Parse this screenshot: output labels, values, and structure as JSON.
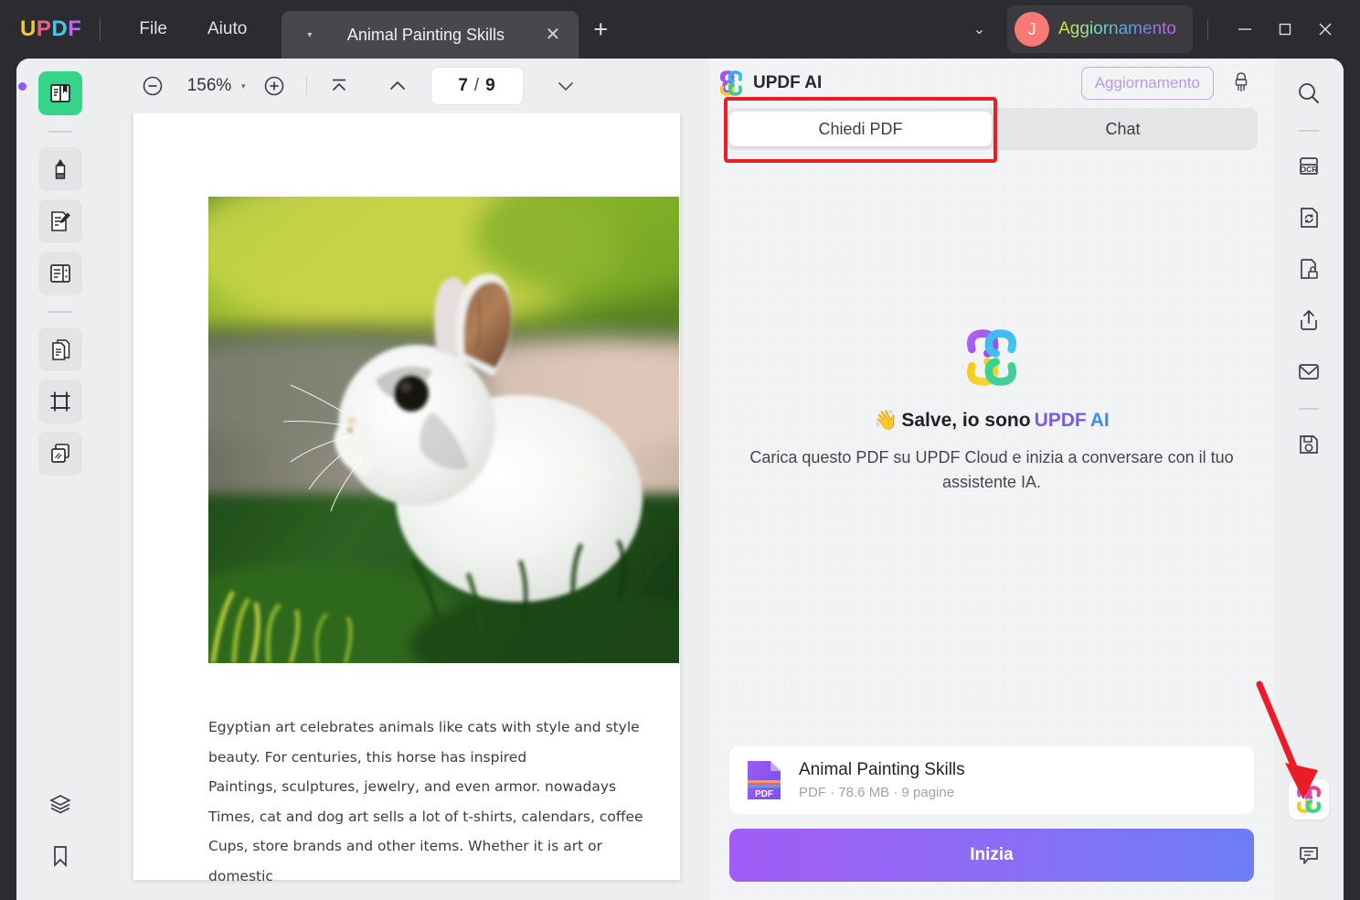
{
  "titlebar": {
    "logo_letters": [
      "U",
      "P",
      "D",
      "F"
    ],
    "menu": [
      {
        "label": "File",
        "name": "menu-file"
      },
      {
        "label": "Aiuto",
        "name": "menu-aiuto"
      }
    ],
    "tab": {
      "title": "Animal Painting Skills",
      "caret": "▾",
      "close": "✕",
      "add": "+"
    },
    "account": {
      "avatar_initial": "J",
      "label": "Aggiornamento"
    },
    "window_controls": {
      "minimize": "—",
      "maximize": "□",
      "close": "✕"
    },
    "chevron": "⌄"
  },
  "left_rail": {
    "items": [
      {
        "name": "sidebar-reader",
        "icon": "reader-book-icon",
        "active": true
      },
      {
        "name": "sidebar-annotate",
        "icon": "highlighter-marker-icon",
        "active": false
      },
      {
        "name": "sidebar-edit-pdf",
        "icon": "document-pencil-icon",
        "active": false
      },
      {
        "name": "sidebar-page-organize",
        "icon": "page-panel-icon",
        "active": false
      },
      {
        "name": "sidebar-convert",
        "icon": "document-copy-icon",
        "active": false
      },
      {
        "name": "sidebar-crop",
        "icon": "crop-icon",
        "active": false
      },
      {
        "name": "sidebar-batch",
        "icon": "stacked-pages-icon",
        "active": false
      }
    ],
    "bottom_items": [
      {
        "name": "sidebar-layers",
        "icon": "layers-icon"
      },
      {
        "name": "sidebar-bookmark",
        "icon": "bookmark-icon"
      }
    ]
  },
  "viewer_toolbar": {
    "zoom_out": "zoom-out-icon",
    "zoom_value": "156%",
    "zoom_caret": "▾",
    "zoom_in": "zoom-in-icon",
    "first_page": "go-first-page-icon",
    "prev_page": "go-previous-page-icon",
    "current_page": "7",
    "page_separator": "/",
    "total_pages": "9",
    "next_page": "go-next-page-icon"
  },
  "document": {
    "image_alt": "white-rabbit-on-grass-photo",
    "paragraph_lines": [
      "Egyptian art celebrates animals like cats with style and style",
      "beauty. For centuries, this horse has inspired",
      "Paintings, sculptures, jewelry, and even armor. nowadays",
      "Times, cat and dog art sells a lot of t-shirts, calendars, coffee",
      "Cups, store brands and other items. Whether it is art or domestic"
    ]
  },
  "ai_panel": {
    "header": {
      "logo": "updf-ai-clover-icon",
      "title": "UPDF AI",
      "upgrade_label": "Aggiornamento",
      "clear_icon": "brush-clear-icon"
    },
    "tabs": [
      {
        "label": "Chiedi PDF",
        "name": "tab-chiedi-pdf",
        "selected": true
      },
      {
        "label": "Chat",
        "name": "tab-chat",
        "selected": false
      }
    ],
    "welcome": {
      "logo": "updf-ai-clover-large-icon",
      "wave_emoji": "👋",
      "greeting_prefix": "Salve, io sono ",
      "greeting_brand_1": "UPDF",
      "greeting_brand_2": " AI",
      "description": "Carica questo PDF su UPDF Cloud e inizia a conversare con il tuo assistente IA."
    },
    "file_card": {
      "icon": "pdf-file-icon",
      "icon_label": "PDF",
      "name": "Animal Painting Skills",
      "meta": "PDF · 78.6 MB · 9 pagine"
    },
    "start_button": "Inizia"
  },
  "right_rail": {
    "items": [
      {
        "name": "tool-search",
        "icon": "search-icon"
      },
      {
        "name": "tool-ocr",
        "icon": "ocr-icon"
      },
      {
        "name": "tool-convert",
        "icon": "convert-document-icon"
      },
      {
        "name": "tool-protect",
        "icon": "document-lock-icon"
      },
      {
        "name": "tool-share",
        "icon": "share-upload-icon"
      },
      {
        "name": "tool-email",
        "icon": "email-envelope-icon"
      },
      {
        "name": "tool-save",
        "icon": "floppy-save-icon"
      }
    ],
    "bottom_items": [
      {
        "name": "tool-updf-ai",
        "icon": "updf-ai-clover-icon"
      },
      {
        "name": "tool-comment",
        "icon": "comment-bubble-icon"
      }
    ]
  },
  "annotation": {
    "arrow": "red-pointer-arrow",
    "highlight_box": "red-highlight-rectangle"
  },
  "colors": {
    "titlebar_bg": "#2c2c30",
    "app_bg": "#eceef0",
    "panel_bg": "#f2f3f4",
    "accent_purple": "#8a5cf0",
    "active_green": "#35d48a",
    "annotation_red": "#ea1c25",
    "avatar_red": "#f97a74"
  }
}
